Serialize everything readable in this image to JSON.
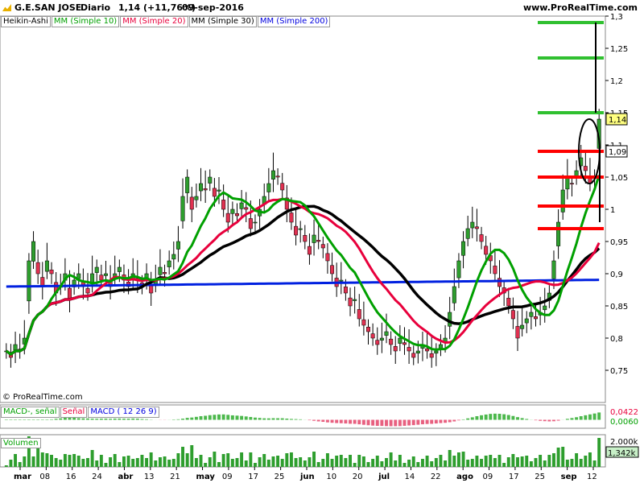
{
  "header": {
    "ticker": "G.E.SAN JOSE",
    "period": "Diario",
    "quote": "1,14 (+11,76%)",
    "date": "09-sep-2016",
    "site": "www.ProRealTime.com"
  },
  "legend": [
    {
      "text": "Heikin-Ashi",
      "color": "#000000"
    },
    {
      "text": "MM (Simple 10)",
      "color": "#00a000"
    },
    {
      "text": "MM (Simple 20)",
      "color": "#e8003c"
    },
    {
      "text": "MM (Simple 30)",
      "color": "#000000"
    },
    {
      "text": "MM (Simple 200)",
      "color": "#0000e0"
    }
  ],
  "copyright": "© ProRealTime.com",
  "macd_legend": [
    {
      "text": "MACD-, señal",
      "color": "#00a000"
    },
    {
      "text": "Señal",
      "color": "#e8003c"
    },
    {
      "text": "MACD ( 12 26 9)",
      "color": "#0000e0"
    }
  ],
  "volume_legend": "Volumen",
  "colors": {
    "up": "#2e9e2e",
    "down": "#e03050",
    "ma10": "#00a000",
    "ma20": "#e8003c",
    "ma30": "#000000",
    "ma200": "#0020e0",
    "target": "#30c030",
    "support": "#ff0000",
    "price_tag": "#ffff80"
  },
  "chart_data": {
    "type": "candlestick",
    "y_axis": {
      "min": 0.7,
      "max": 1.3,
      "ticks": [
        "1,3",
        "1,25",
        "1,2",
        "1,15",
        "1,1",
        "1,05",
        "1",
        "0,95",
        "0,9",
        "0,85",
        "0,8",
        "0,75"
      ],
      "tick_values": [
        1.3,
        1.25,
        1.2,
        1.15,
        1.1,
        1.05,
        1.0,
        0.95,
        0.9,
        0.85,
        0.8,
        0.75
      ],
      "current_price_label": "1,14",
      "current_price": 1.14,
      "secondary_label": "1,09",
      "secondary_value": 1.09
    },
    "x_axis_labels": [
      "mar",
      "08",
      "16",
      "24",
      "abr",
      "13",
      "21",
      "may",
      "09",
      "17",
      "25",
      "jun",
      "10",
      "20",
      "jul",
      "14",
      "22",
      "ago",
      "09",
      "17",
      "25",
      "sep",
      "12"
    ],
    "bold_labels": [
      "mar",
      "abr",
      "may",
      "jun",
      "jul",
      "ago",
      "sep"
    ],
    "close_series": [
      0.78,
      0.77,
      0.79,
      0.78,
      0.8,
      0.92,
      0.95,
      0.9,
      0.88,
      0.92,
      0.9,
      0.87,
      0.88,
      0.9,
      0.86,
      0.89,
      0.9,
      0.88,
      0.87,
      0.9,
      0.91,
      0.89,
      0.9,
      0.88,
      0.9,
      0.91,
      0.89,
      0.88,
      0.9,
      0.89,
      0.88,
      0.9,
      0.87,
      0.89,
      0.91,
      0.9,
      0.92,
      0.93,
      0.95,
      1.02,
      1.05,
      1.0,
      1.02,
      1.04,
      1.03,
      1.05,
      1.02,
      1.03,
      1.0,
      0.98,
      1.0,
      0.99,
      1.01,
      1.0,
      0.97,
      0.98,
      1.0,
      1.02,
      1.04,
      1.06,
      1.05,
      1.03,
      1.0,
      0.98,
      0.96,
      0.97,
      0.95,
      0.93,
      0.96,
      0.95,
      0.94,
      0.92,
      0.9,
      0.88,
      0.89,
      0.87,
      0.85,
      0.86,
      0.83,
      0.82,
      0.81,
      0.8,
      0.79,
      0.8,
      0.81,
      0.79,
      0.78,
      0.8,
      0.79,
      0.78,
      0.77,
      0.78,
      0.79,
      0.78,
      0.77,
      0.78,
      0.79,
      0.8,
      0.84,
      0.88,
      0.92,
      0.95,
      0.97,
      0.98,
      0.97,
      0.95,
      0.93,
      0.92,
      0.9,
      0.88,
      0.87,
      0.85,
      0.83,
      0.8,
      0.82,
      0.83,
      0.84,
      0.83,
      0.84,
      0.85,
      0.87,
      0.92,
      0.98,
      1.03,
      1.05,
      1.04,
      1.06,
      1.08,
      1.06,
      1.04,
      1.05,
      1.14
    ],
    "volume_axis": {
      "label": "2.000k",
      "current": "1,342k"
    },
    "macd_axis": {
      "macd": "0,0422",
      "signal": "0,0060"
    },
    "annotations": {
      "target_levels": [
        1.29,
        1.235,
        1.15
      ],
      "support_levels": [
        1.09,
        1.05,
        1.005,
        0.97
      ]
    }
  }
}
